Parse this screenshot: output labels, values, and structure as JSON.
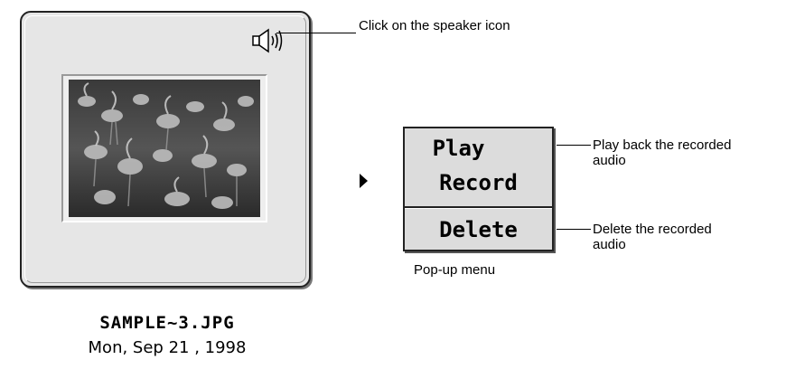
{
  "thumbnail": {
    "filename": "SAMPLE~3.JPG",
    "date": "Mon, Sep 21 , 1998",
    "speaker_icon": "speaker-icon",
    "photo_subject": "flamingo-photo"
  },
  "callouts": {
    "speaker": "Click on the speaker icon",
    "play_line1": "Play back the recorded",
    "play_line2": "audio",
    "delete_line1": "Delete the recorded",
    "delete_line2": "audio"
  },
  "popup_menu": {
    "items": [
      {
        "label": "Play"
      },
      {
        "label": "Record"
      },
      {
        "label": "Delete"
      }
    ],
    "caption": "Pop-up menu"
  },
  "colors": {
    "card_background": "#e6e6e6",
    "menu_background": "#dcdcdc"
  }
}
